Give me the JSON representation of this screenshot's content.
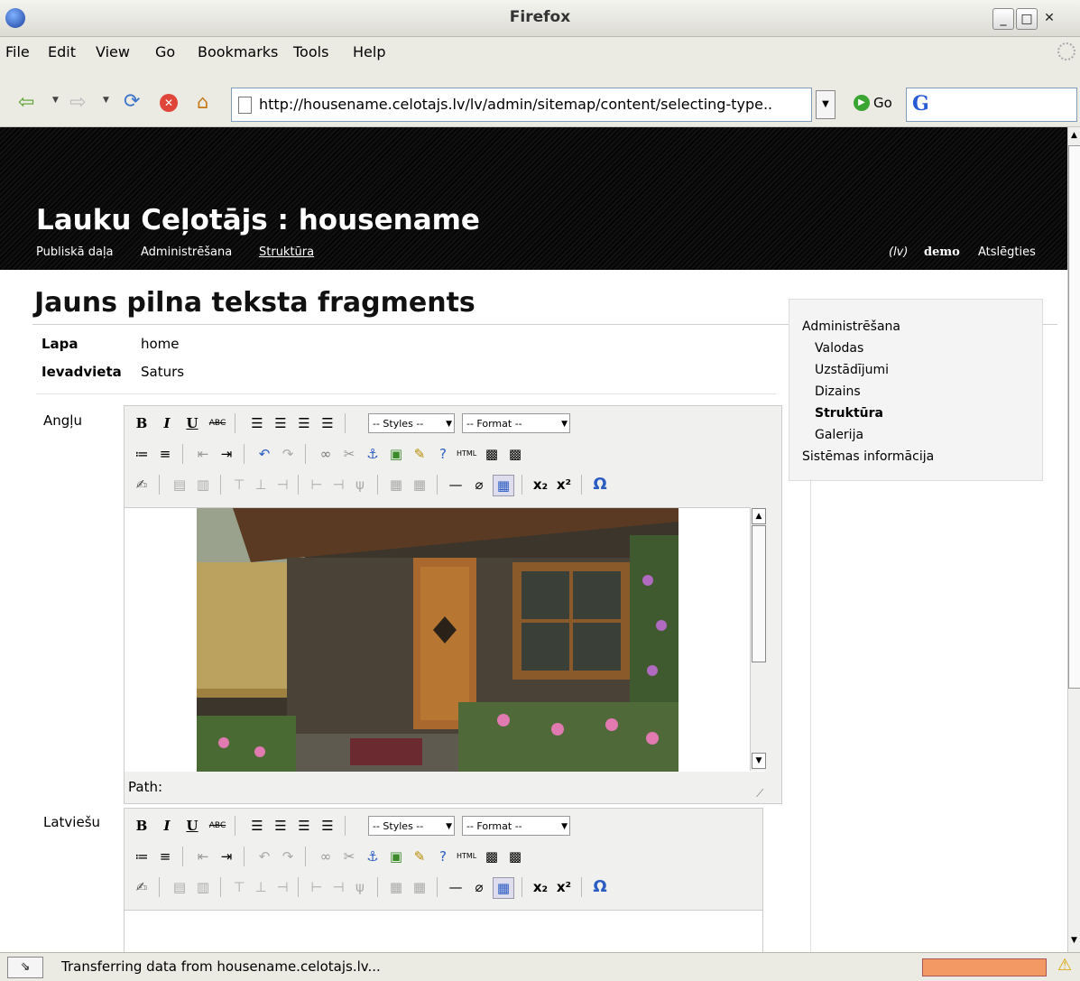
{
  "window": {
    "title": "Firefox"
  },
  "menubar": {
    "items": [
      "File",
      "Edit",
      "View",
      "Go",
      "Bookmarks",
      "Tools",
      "Help"
    ]
  },
  "navbar": {
    "url": "http://housename.celotajs.lv/lv/admin/sitemap/content/selecting-type..",
    "go_label": "Go"
  },
  "header": {
    "site_title": "Lauku Ceļotājs : housename",
    "links": [
      "Publiskā daļa",
      "Administrēšana",
      "Struktūra"
    ],
    "lang": "(lv)",
    "user": "demo",
    "logout": "Atslēgties"
  },
  "content": {
    "title": "Jauns pilna teksta fragments",
    "fields": [
      {
        "label": "Lapa",
        "value": "home"
      },
      {
        "label": "Ievadvieta",
        "value": "Saturs"
      }
    ],
    "editors": [
      {
        "label": "Angļu",
        "styles": "-- Styles --",
        "format": "-- Format --",
        "path_label": "Path:"
      },
      {
        "label": "Latviešu",
        "styles": "-- Styles --",
        "format": "-- Format --"
      }
    ]
  },
  "sidebar": {
    "items": [
      {
        "label": "Administrēšana",
        "level": 0
      },
      {
        "label": "Valodas",
        "level": 1
      },
      {
        "label": "Uzstādījumi",
        "level": 1
      },
      {
        "label": "Dizains",
        "level": 1
      },
      {
        "label": "Struktūra",
        "level": 1,
        "active": true
      },
      {
        "label": "Galerija",
        "level": 1
      },
      {
        "label": "Sistēmas informācija",
        "level": 0
      }
    ]
  },
  "toolbar_icons": {
    "row1": [
      "bold",
      "italic",
      "underline",
      "strikethrough",
      "align-left",
      "align-center",
      "align-right",
      "align-justify"
    ],
    "row2": [
      "bullet-list",
      "numbered-list",
      "outdent",
      "indent",
      "undo",
      "redo",
      "link",
      "unlink",
      "anchor",
      "image",
      "cleanup",
      "help",
      "html",
      "media",
      "media2"
    ],
    "row3": [
      "edit",
      "table-row",
      "table-cell",
      "insert-row-before",
      "insert-row-after",
      "delete-row",
      "insert-col-before",
      "insert-col-after",
      "delete-col",
      "merge",
      "split",
      "hr",
      "remove-format",
      "visual-aid",
      "subscript",
      "superscript",
      "special-char"
    ]
  },
  "statusbar": {
    "text": "Transferring data from housename.celotajs.lv..."
  }
}
